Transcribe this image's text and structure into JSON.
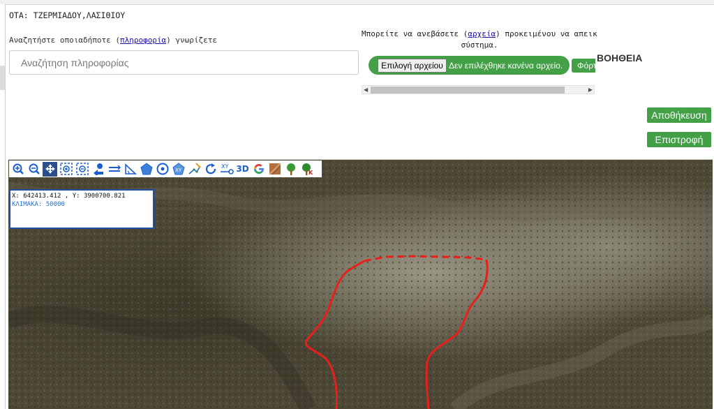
{
  "header": {
    "ota": "ΟΤΑ: ΤΖΕΡΜΙΑΔΟΥ,ΛΑΣΙΘΙΟΥ"
  },
  "search": {
    "label_prefix": "Αναζητήστε οποιαδήποτε (",
    "label_link": "πληροφορία",
    "label_suffix": ") γνωρίζετε",
    "placeholder": "Αναζήτηση πληροφορίας"
  },
  "upload": {
    "text_prefix": "Μπορείτε να ανεβάσετε (",
    "text_link": "αρχεία",
    "text_suffix": ") προκειμένου να απεικονιστο",
    "text_line2": "σύστημα.",
    "choose_file_label": "Επιλογή αρχείου",
    "no_file_status": "Δεν επιλέχθηκε κανένα αρχείο.",
    "upload_button_label": "Φόρτ"
  },
  "help_label": "ΒΟΗΘΕΙΑ",
  "actions": {
    "save_label": "Αποθήκευση",
    "back_label": "Επιστροφή"
  },
  "map": {
    "coordinates": "X: 642413.412 , Y: 3900700.821",
    "scale": "ΚΛΙΜΑΚΑ: 50000",
    "tools": [
      {
        "name": "zoom-in-icon"
      },
      {
        "name": "zoom-out-icon"
      },
      {
        "name": "pan-icon"
      },
      {
        "name": "zoom-box-in-icon"
      },
      {
        "name": "zoom-box-out-icon"
      },
      {
        "name": "previous-extent-icon"
      },
      {
        "name": "measure-length-icon"
      },
      {
        "name": "measure-angle-icon"
      },
      {
        "name": "polygon-icon"
      },
      {
        "name": "circle-icon"
      },
      {
        "name": "xy-polygon-icon"
      },
      {
        "name": "edit-line-icon"
      },
      {
        "name": "refresh-icon"
      },
      {
        "name": "xy-goto-icon"
      },
      {
        "name": "3d-view-icon",
        "label": "3D"
      },
      {
        "name": "google-icon"
      },
      {
        "name": "ortho-layer-icon"
      },
      {
        "name": "tree-layer-icon"
      },
      {
        "name": "forest-layer-icon"
      }
    ],
    "colors": {
      "boundary": "#e8201c",
      "coord_border": "#1f4fa8",
      "scale_text": "#1f6fd0",
      "button_green": "#43a047"
    }
  }
}
